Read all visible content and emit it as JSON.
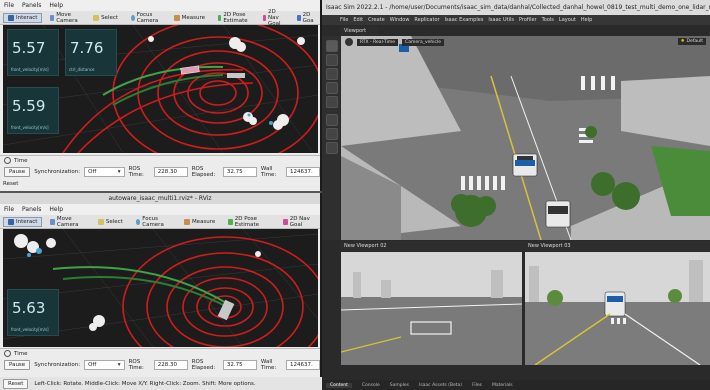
{
  "rviz_top": {
    "menu": [
      "File",
      "Panels",
      "Help"
    ],
    "tools": [
      {
        "label": "Interact",
        "icon": "cursor-icon",
        "active": true
      },
      {
        "label": "Move Camera",
        "icon": "move-camera-icon"
      },
      {
        "label": "Select",
        "icon": "select-icon"
      },
      {
        "label": "Focus Camera",
        "icon": "focus-camera-icon"
      },
      {
        "label": "Measure",
        "icon": "measure-icon"
      },
      {
        "label": "2D Pose Estimate",
        "icon": "pose-estimate-icon"
      },
      {
        "label": "2D Nav Goal",
        "icon": "nav-goal-icon"
      },
      {
        "label": "2D Goa",
        "icon": "goal-icon"
      }
    ],
    "panels": [
      {
        "value": "5.57",
        "caption": "front_velocity[m/s]"
      },
      {
        "value": "7.76",
        "caption": "ctrl_distance"
      },
      {
        "value": "5.59",
        "caption": "front_velocity[m/s]"
      }
    ],
    "time": {
      "title": "Time",
      "pause": "Pause",
      "sync_label": "Synchronization:",
      "sync_value": "Off",
      "ros_time_label": "ROS Time:",
      "ros_time": "228.30",
      "ros_elapsed_label": "ROS Elapsed:",
      "ros_elapsed": "32.75",
      "wall_time_label": "Wall Time:",
      "wall_time": "124637."
    },
    "reset": "Reset"
  },
  "rviz_bottom": {
    "window_title": "autoware_isaac_multi1.rviz* - RViz",
    "menu": [
      "File",
      "Panels",
      "Help"
    ],
    "tools": [
      {
        "label": "Interact",
        "icon": "cursor-icon",
        "active": true
      },
      {
        "label": "Move Camera",
        "icon": "move-camera-icon"
      },
      {
        "label": "Select",
        "icon": "select-icon"
      },
      {
        "label": "Focus Camera",
        "icon": "focus-camera-icon"
      },
      {
        "label": "Measure",
        "icon": "measure-icon"
      },
      {
        "label": "2D Pose Estimate",
        "icon": "pose-estimate-icon"
      },
      {
        "label": "2D Nav Goal",
        "icon": "nav-goal-icon"
      }
    ],
    "panels": [
      {
        "value": "5.63",
        "caption": "front_velocity[m/s]"
      }
    ],
    "time": {
      "title": "Time",
      "pause": "Pause",
      "sync_label": "Synchronization:",
      "sync_value": "Off",
      "ros_time_label": "ROS Time:",
      "ros_time": "228.30",
      "ros_elapsed_label": "ROS Elapsed:",
      "ros_elapsed": "32.75",
      "wall_time_label": "Wall Time:",
      "wall_time": "124637."
    },
    "reset": "Reset",
    "status": "Left-Click: Rotate. Middle-Click: Move X/Y. Right-Click: Zoom. Shift: More options."
  },
  "isaac": {
    "title": "Isaac Sim 2022.2.1 - /home/user/Documents/isaac_sim_data/danhal/Collected_danhal_howel_0819_test_multi_demo_one_lidar_no_path_generat",
    "menu": [
      "File",
      "Edit",
      "Create",
      "Window",
      "Replicator",
      "Isaac Examples",
      "Isaac Utils",
      "Profiler",
      "Tools",
      "Layout",
      "Help"
    ],
    "viewport_tab": "Viewport",
    "render_mode": "RTX - Real-Time",
    "camera": "Camera_vehicle",
    "default_label": "Default",
    "viewport2_tab": "New Viewport 02",
    "viewport3_tab": "New Viewport 03",
    "bottom_tabs": [
      "Content",
      "Console",
      "Samples",
      "Isaac Assets (Beta)",
      "Files",
      "Materials"
    ]
  }
}
